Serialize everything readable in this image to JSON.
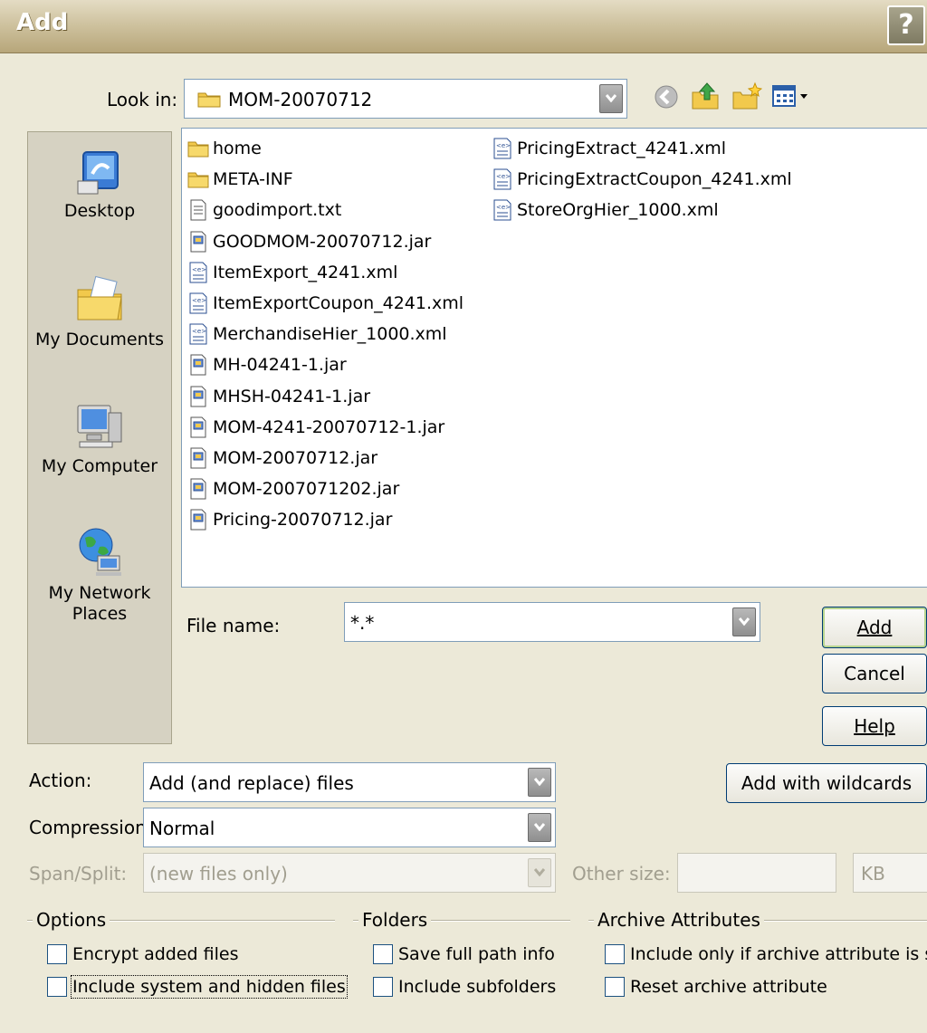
{
  "window": {
    "title": "Add",
    "help_glyph": "?"
  },
  "look_in": {
    "label": "Look in:",
    "value": "MOM-20070712",
    "toolbar_icons": [
      "back-icon",
      "up-folder-icon",
      "new-folder-icon",
      "view-menu-icon"
    ]
  },
  "places": [
    {
      "label": "Desktop",
      "icon": "desktop-icon"
    },
    {
      "label": "My Documents",
      "icon": "my-documents-icon"
    },
    {
      "label": "My Computer",
      "icon": "my-computer-icon"
    },
    {
      "label": "My Network Places",
      "icon": "network-places-icon"
    }
  ],
  "files": [
    {
      "name": "home",
      "icon": "folder-icon"
    },
    {
      "name": "META-INF",
      "icon": "folder-icon"
    },
    {
      "name": "goodimport.txt",
      "icon": "text-file-icon"
    },
    {
      "name": "GOODMOM-20070712.jar",
      "icon": "jar-file-icon"
    },
    {
      "name": "ItemExport_4241.xml",
      "icon": "xml-file-icon"
    },
    {
      "name": "ItemExportCoupon_4241.xml",
      "icon": "xml-file-icon"
    },
    {
      "name": "MerchandiseHier_1000.xml",
      "icon": "xml-file-icon"
    },
    {
      "name": "MH-04241-1.jar",
      "icon": "jar-file-icon"
    },
    {
      "name": "MHSH-04241-1.jar",
      "icon": "jar-file-icon"
    },
    {
      "name": "MOM-4241-20070712-1.jar",
      "icon": "jar-file-icon"
    },
    {
      "name": "MOM-20070712.jar",
      "icon": "jar-file-icon"
    },
    {
      "name": "MOM-2007071202.jar",
      "icon": "jar-file-icon"
    },
    {
      "name": "Pricing-20070712.jar",
      "icon": "jar-file-icon"
    },
    {
      "name": "PricingExtract_4241.xml",
      "icon": "xml-file-icon"
    },
    {
      "name": "PricingExtractCoupon_4241.xml",
      "icon": "xml-file-icon"
    },
    {
      "name": "StoreOrgHier_1000.xml",
      "icon": "xml-file-icon"
    }
  ],
  "file_name": {
    "label": "File name:",
    "value": "*.*"
  },
  "buttons": {
    "add": "Add",
    "cancel": "Cancel",
    "help": "Help",
    "add_wildcards": "Add with wildcards"
  },
  "action": {
    "label": "Action:",
    "value": "Add (and replace) files"
  },
  "compression": {
    "label": "Compression:",
    "value": "Normal"
  },
  "span": {
    "label": "Span/Split:",
    "value": "(new files only)",
    "other_size_label": "Other size:",
    "other_size_value": "",
    "unit": "KB"
  },
  "options": {
    "title": "Options",
    "items": [
      {
        "label": "Encrypt added files",
        "checked": false
      },
      {
        "label": "Include system and hidden files",
        "checked": false
      }
    ]
  },
  "folders": {
    "title": "Folders",
    "items": [
      {
        "label": "Save full path info",
        "checked": false
      },
      {
        "label": "Include subfolders",
        "checked": false
      }
    ]
  },
  "archive": {
    "title": "Archive Attributes",
    "items": [
      {
        "label": "Include only if archive attribute is set",
        "checked": false
      },
      {
        "label": "Reset archive attribute",
        "checked": false
      }
    ]
  },
  "colors": {
    "dialog_bg": "#ece9d8",
    "border_blue": "#7f9db9",
    "button_border": "#003c74"
  }
}
